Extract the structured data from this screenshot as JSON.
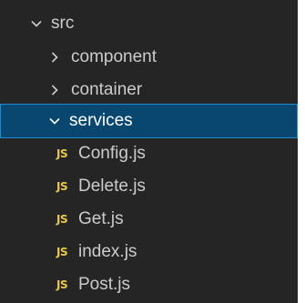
{
  "explorer": {
    "root": {
      "label": "src",
      "icon": "chevron-down-icon",
      "expanded": true
    },
    "folders": [
      {
        "label": "component",
        "icon": "chevron-right-icon",
        "expanded": false,
        "selected": false
      },
      {
        "label": "container",
        "icon": "chevron-right-icon",
        "expanded": false,
        "selected": false
      },
      {
        "label": "services",
        "icon": "chevron-down-icon",
        "expanded": true,
        "selected": true
      }
    ],
    "files": [
      {
        "badge": "JS",
        "label": "Config.js"
      },
      {
        "badge": "JS",
        "label": "Delete.js"
      },
      {
        "badge": "JS",
        "label": "Get.js"
      },
      {
        "badge": "JS",
        "label": "index.js"
      },
      {
        "badge": "JS",
        "label": "Post.js"
      }
    ]
  },
  "colors": {
    "background": "#252526",
    "selection_bg": "#094771",
    "selection_border": "#1d8ad6",
    "text": "#cccccc",
    "js_badge": "#e8c84a"
  }
}
